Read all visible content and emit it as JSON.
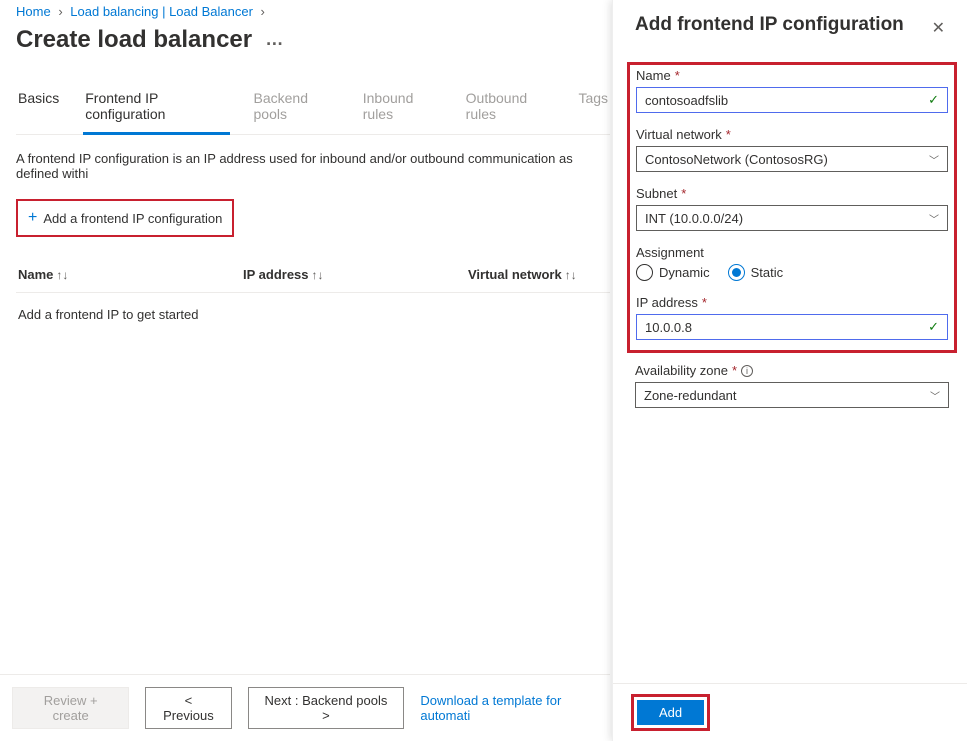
{
  "breadcrumb": {
    "home": "Home",
    "lb": "Load balancing | Load Balancer"
  },
  "pageTitle": "Create load balancer",
  "tabs": {
    "basics": "Basics",
    "frontend": "Frontend IP configuration",
    "backend": "Backend pools",
    "inbound": "Inbound rules",
    "outbound": "Outbound rules",
    "tags": "Tags"
  },
  "description": "A frontend IP configuration is an IP address used for inbound and/or outbound communication as defined withi",
  "addFrontend": "Add a frontend IP configuration",
  "columns": {
    "name": "Name",
    "ip": "IP address",
    "vnet": "Virtual network"
  },
  "emptyRow": "Add a frontend IP to get started",
  "footer": {
    "review": "Review + create",
    "previous": "< Previous",
    "next": "Next : Backend pools >",
    "template": "Download a template for automati"
  },
  "panel": {
    "title": "Add frontend IP configuration",
    "labels": {
      "name": "Name",
      "vnet": "Virtual network",
      "subnet": "Subnet",
      "assignment": "Assignment",
      "ip": "IP address",
      "zone": "Availability zone"
    },
    "values": {
      "name": "contosoadfslib",
      "vnet": "ContosoNetwork (ContososRG)",
      "subnet": "INT (10.0.0.0/24)",
      "ip": "10.0.0.8",
      "zone": "Zone-redundant"
    },
    "radio": {
      "dynamic": "Dynamic",
      "static": "Static"
    },
    "addBtn": "Add"
  }
}
